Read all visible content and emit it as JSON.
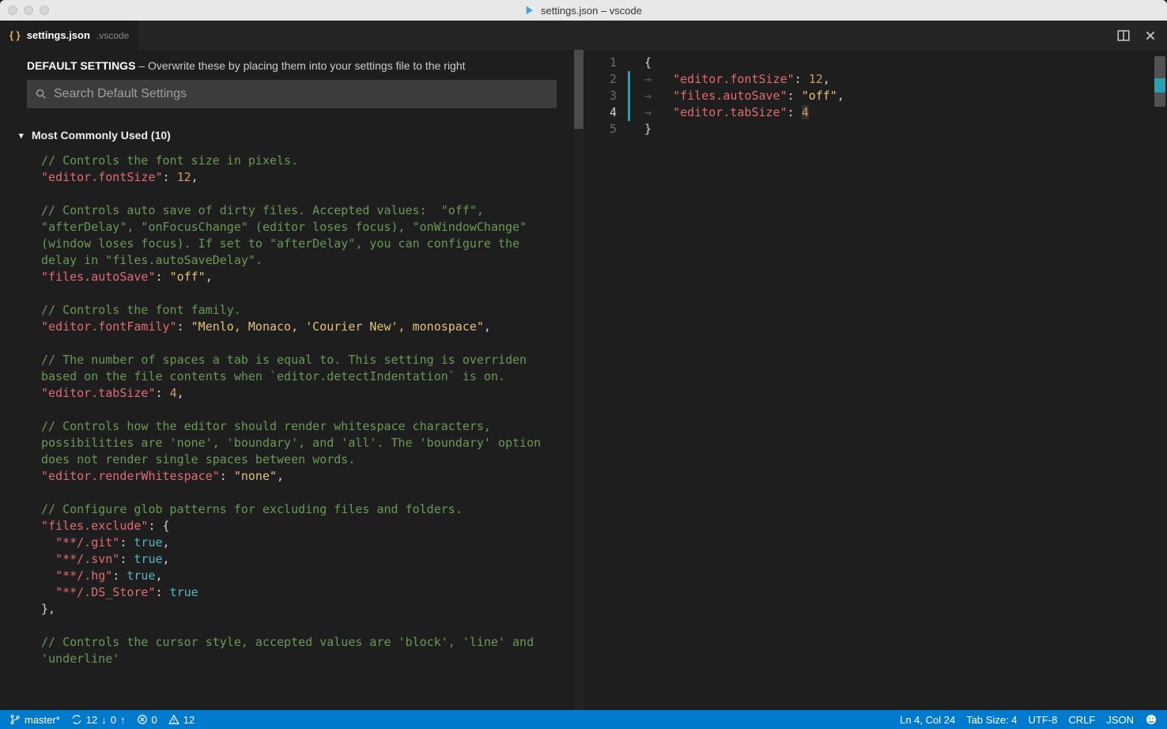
{
  "window": {
    "title": "settings.json – vscode"
  },
  "tab": {
    "filename": "settings.json",
    "folder": ".vscode"
  },
  "leftPane": {
    "headingStrong": "DEFAULT SETTINGS",
    "headingRest": " – Overwrite these by placing them into your settings file to the right",
    "searchPlaceholder": "Search Default Settings",
    "sectionTitle": "Most Commonly Used (10)",
    "settings": [
      {
        "comment": "// Controls the font size in pixels.",
        "key": "\"editor.fontSize\"",
        "value": "12",
        "valueType": "num",
        "trailing": ","
      },
      {
        "comment": "// Controls auto save of dirty files. Accepted values:  \"off\", \"afterDelay\", \"onFocusChange\" (editor loses focus), \"onWindowChange\" (window loses focus). If set to \"afterDelay\", you can configure the delay in \"files.autoSaveDelay\".",
        "key": "\"files.autoSave\"",
        "value": "\"off\"",
        "valueType": "str",
        "trailing": ","
      },
      {
        "comment": "// Controls the font family.",
        "key": "\"editor.fontFamily\"",
        "value": "\"Menlo, Monaco, 'Courier New', monospace\"",
        "valueType": "str",
        "trailing": ","
      },
      {
        "comment": "// The number of spaces a tab is equal to. This setting is overriden based on the file contents when `editor.detectIndentation` is on.",
        "key": "\"editor.tabSize\"",
        "value": "4",
        "valueType": "num",
        "trailing": ","
      },
      {
        "comment": "// Controls how the editor should render whitespace characters, possibilities are 'none', 'boundary', and 'all'. The 'boundary' option does not render single spaces between words.",
        "key": "\"editor.renderWhitespace\"",
        "value": "\"none\"",
        "valueType": "str",
        "trailing": ","
      },
      {
        "comment": "// Configure glob patterns for excluding files and folders.",
        "key": "\"files.exclude\"",
        "value": "object",
        "valueType": "obj",
        "object": [
          {
            "k": "\"**/.git\"",
            "v": "true",
            "t": ","
          },
          {
            "k": "\"**/.svn\"",
            "v": "true",
            "t": ","
          },
          {
            "k": "\"**/.hg\"",
            "v": "true",
            "t": ","
          },
          {
            "k": "\"**/.DS_Store\"",
            "v": "true",
            "t": ""
          }
        ],
        "trailing": ","
      },
      {
        "comment": "// Controls the cursor style, accepted values are 'block', 'line' and 'underline'",
        "key": "",
        "value": "",
        "valueType": "none",
        "trailing": ""
      }
    ]
  },
  "rightPane": {
    "lines": [
      {
        "n": 1,
        "mod": false,
        "indent": "",
        "tokens": [
          {
            "t": "punc",
            "v": "{"
          }
        ]
      },
      {
        "n": 2,
        "mod": true,
        "indent": "→   ",
        "tokens": [
          {
            "t": "key",
            "v": "\"editor.fontSize\""
          },
          {
            "t": "punc",
            "v": ": "
          },
          {
            "t": "num",
            "v": "12"
          },
          {
            "t": "punc",
            "v": ","
          }
        ]
      },
      {
        "n": 3,
        "mod": true,
        "indent": "→   ",
        "tokens": [
          {
            "t": "key",
            "v": "\"files.autoSave\""
          },
          {
            "t": "punc",
            "v": ": "
          },
          {
            "t": "str",
            "v": "\"off\""
          },
          {
            "t": "punc",
            "v": ","
          }
        ]
      },
      {
        "n": 4,
        "mod": true,
        "indent": "→   ",
        "tokens": [
          {
            "t": "key",
            "v": "\"editor.tabSize\""
          },
          {
            "t": "punc",
            "v": ": "
          },
          {
            "t": "num",
            "v": "4",
            "cursor": true
          }
        ]
      },
      {
        "n": 5,
        "mod": false,
        "indent": "",
        "tokens": [
          {
            "t": "punc",
            "v": "}"
          }
        ]
      }
    ],
    "activeLine": 4
  },
  "status": {
    "branch": "master*",
    "syncDown": "12",
    "syncUp": "0",
    "errors": "0",
    "warnings": "12",
    "lnCol": "Ln 4, Col 24",
    "tabSize": "Tab Size: 4",
    "encoding": "UTF-8",
    "eol": "CRLF",
    "lang": "JSON"
  }
}
